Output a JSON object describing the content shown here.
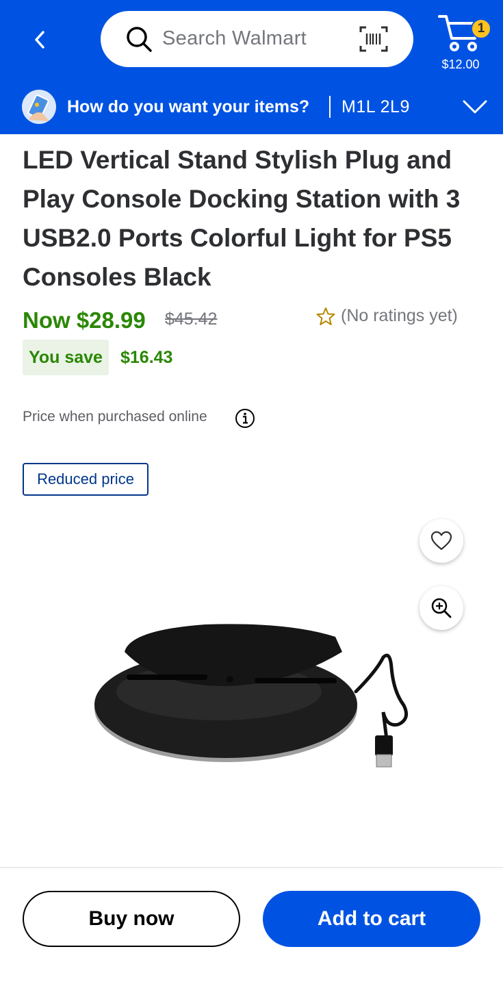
{
  "header": {
    "search_placeholder": "Search Walmart",
    "cart_count": "1",
    "cart_total": "$12.00"
  },
  "delivery": {
    "question": "How do you want your items?",
    "postal_code": "M1L 2L9"
  },
  "product": {
    "title": "LED Vertical Stand Stylish Plug and Play Console Docking Station with 3 USB2.0 Ports Colorful Light for PS5 Consoles Black",
    "now_price": "Now $28.99",
    "was_price": "$45.42",
    "ratings_text": "(No ratings yet)",
    "save_label": "You save",
    "save_amount": "$16.43",
    "price_note": "Price when purchased online",
    "badge": "Reduced price"
  },
  "actions": {
    "buy_now": "Buy now",
    "add_to_cart": "Add to cart"
  },
  "colors": {
    "brand_blue": "#0053e2",
    "price_green": "#2a8703",
    "spark_yellow": "#ffc220"
  },
  "icons": [
    "back-chevron-icon",
    "search-icon",
    "barcode-scan-icon",
    "cart-icon",
    "chevron-down-icon",
    "star-icon",
    "info-icon",
    "heart-icon",
    "zoom-in-icon"
  ]
}
